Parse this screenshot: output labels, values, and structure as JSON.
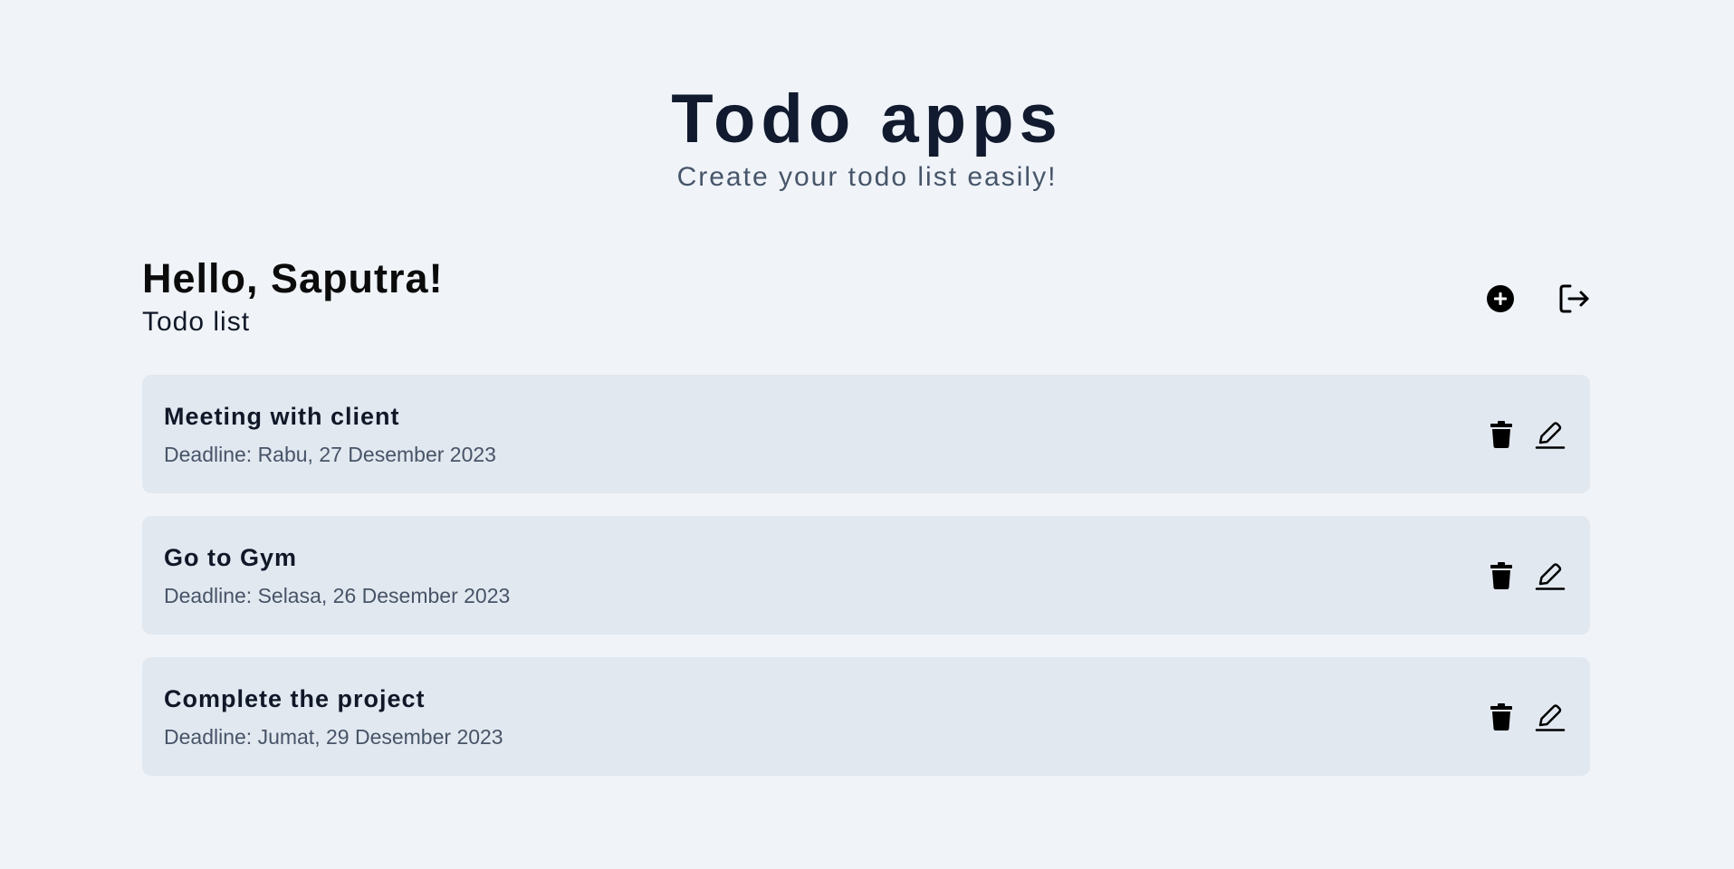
{
  "header": {
    "title": "Todo apps",
    "subtitle": "Create your todo list easily!"
  },
  "greeting": {
    "text": "Hello, Saputra!",
    "subheading": "Todo list"
  },
  "toolbar": {
    "add_icon": "plus-circle-icon",
    "logout_icon": "logout-icon"
  },
  "todos": [
    {
      "title": "Meeting with client",
      "deadline": "Deadline: Rabu, 27 Desember 2023"
    },
    {
      "title": "Go to Gym",
      "deadline": "Deadline: Selasa, 26 Desember 2023"
    },
    {
      "title": "Complete the project",
      "deadline": "Deadline: Jumat, 29 Desember 2023"
    }
  ],
  "item_icons": {
    "delete": "trash-icon",
    "edit": "pencil-icon"
  },
  "colors": {
    "background": "#f0f4f9",
    "card": "#e2e8f0",
    "title": "#111a2e",
    "muted": "#475569"
  }
}
